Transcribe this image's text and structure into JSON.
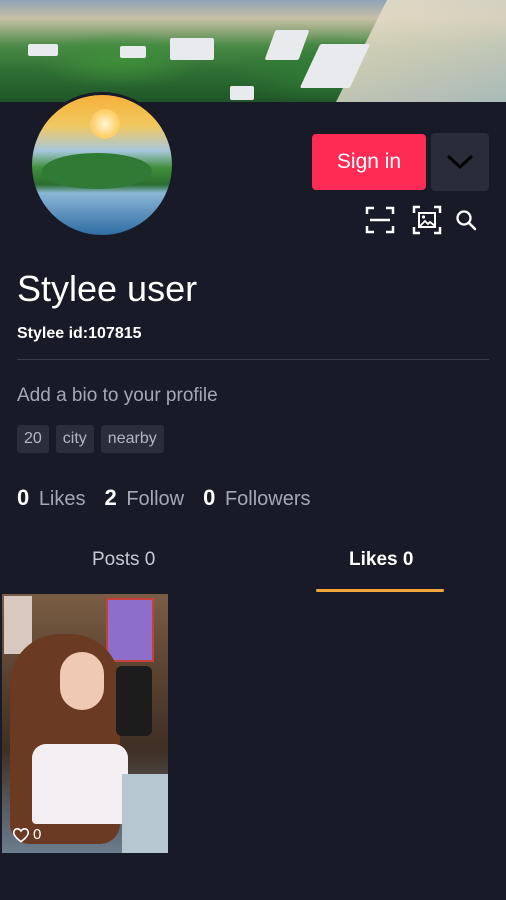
{
  "header": {
    "signin_label": "Sign in"
  },
  "profile": {
    "name": "Stylee user",
    "id_text": "Stylee id:107815",
    "bio_placeholder": "Add a bio to your profile",
    "tags": [
      "20",
      "city",
      "nearby"
    ]
  },
  "stats": {
    "likes": {
      "count": "0",
      "label": "Likes"
    },
    "follow": {
      "count": "2",
      "label": "Follow"
    },
    "followers": {
      "count": "0",
      "label": "Followers"
    }
  },
  "tabs": {
    "posts": "Posts 0",
    "likes": "Likes 0",
    "active": "likes"
  },
  "grid": [
    {
      "likes": "0"
    }
  ],
  "icons": {
    "more": "chevron-down-icon",
    "scan": "scan-icon",
    "image": "image-icon",
    "search": "search-icon",
    "heart": "heart-icon"
  },
  "colors": {
    "background": "#181a27",
    "accent": "#fe2c55",
    "tab_indicator": "#f2a63a"
  }
}
